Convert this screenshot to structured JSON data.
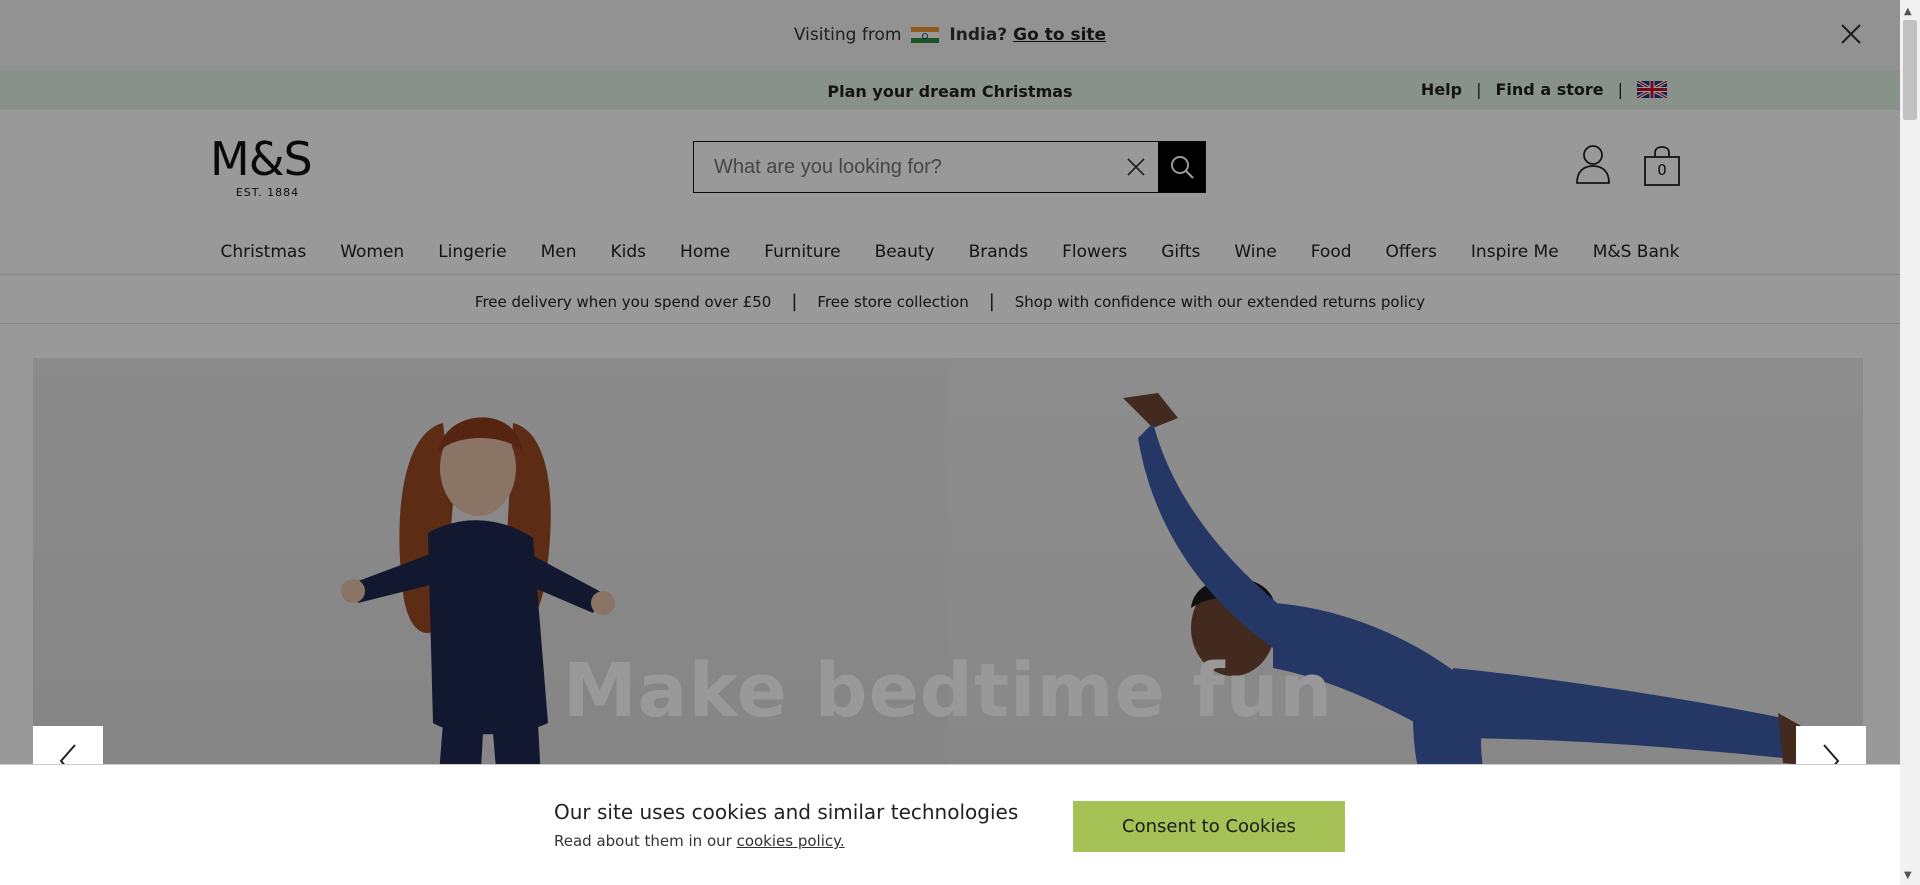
{
  "geo_banner": {
    "visiting_label": "Visiting from",
    "country": "India?",
    "go_link": "Go to site"
  },
  "promo": {
    "headline": "Plan your dream Christmas",
    "help": "Help",
    "separator": "|",
    "find_store": "Find a store"
  },
  "header": {
    "logo": "M&S",
    "logo_est": "EST. 1884",
    "search_placeholder": "What are you looking for?",
    "bag_count": "0"
  },
  "nav": {
    "items": [
      "Christmas",
      "Women",
      "Lingerie",
      "Men",
      "Kids",
      "Home",
      "Furniture",
      "Beauty",
      "Brands",
      "Flowers",
      "Gifts",
      "Wine",
      "Food",
      "Offers",
      "Inspire Me",
      "M&S Bank"
    ]
  },
  "usp": {
    "item1": "Free delivery when you spend over £50",
    "item2": "Free store collection",
    "item3": "Shop with confidence with our extended returns policy",
    "separator": "|"
  },
  "hero": {
    "headline": "Make bedtime fun"
  },
  "cookie": {
    "title": "Our site uses cookies and similar technologies",
    "sub_prefix": "Read about them in our",
    "link": "cookies policy.",
    "button": "Consent to Cookies"
  },
  "colors": {
    "promo_bg": "#e5f3e6",
    "consent_green": "#a6c156",
    "overlay": "rgba(0,0,0,0.4)"
  }
}
